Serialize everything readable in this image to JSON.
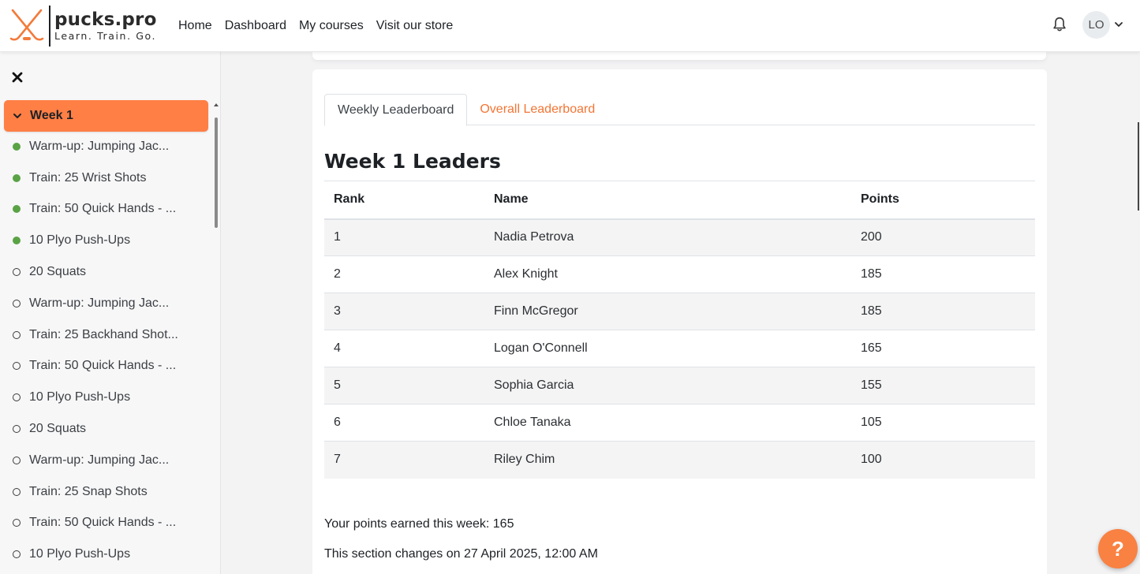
{
  "brand": {
    "name": "pucks.pro",
    "tagline": "Learn. Train. Go.",
    "accent_color": "#ff7f45",
    "stick_color": "#f37a3a"
  },
  "nav": {
    "links": [
      "Home",
      "Dashboard",
      "My courses",
      "Visit our store"
    ]
  },
  "user": {
    "initials": "LO"
  },
  "course_index": {
    "section_title": "Week 1",
    "activities": [
      {
        "label": "Warm-up: Jumping Jac...",
        "completed": true
      },
      {
        "label": "Train: 25 Wrist Shots",
        "completed": true
      },
      {
        "label": "Train: 50 Quick Hands - ...",
        "completed": true
      },
      {
        "label": "10 Plyo Push-Ups",
        "completed": true
      },
      {
        "label": "20 Squats",
        "completed": false
      },
      {
        "label": "Warm-up: Jumping Jac...",
        "completed": false
      },
      {
        "label": "Train: 25 Backhand Shot...",
        "completed": false
      },
      {
        "label": "Train: 50 Quick Hands - ...",
        "completed": false
      },
      {
        "label": "10 Plyo Push-Ups",
        "completed": false
      },
      {
        "label": "20 Squats",
        "completed": false
      },
      {
        "label": "Warm-up: Jumping Jac...",
        "completed": false
      },
      {
        "label": "Train: 25 Snap Shots",
        "completed": false
      },
      {
        "label": "Train: 50 Quick Hands - ...",
        "completed": false
      },
      {
        "label": "10 Plyo Push-Ups",
        "completed": false
      }
    ]
  },
  "tabs": {
    "weekly": "Weekly Leaderboard",
    "overall": "Overall Leaderboard"
  },
  "leaderboard": {
    "heading": "Week 1 Leaders",
    "columns": {
      "rank": "Rank",
      "name": "Name",
      "points": "Points"
    },
    "rows": [
      {
        "rank": "1",
        "name": "Nadia Petrova",
        "points": "200"
      },
      {
        "rank": "2",
        "name": "Alex Knight",
        "points": "185"
      },
      {
        "rank": "3",
        "name": "Finn McGregor",
        "points": "185"
      },
      {
        "rank": "4",
        "name": "Logan O'Connell",
        "points": "165"
      },
      {
        "rank": "5",
        "name": "Sophia Garcia",
        "points": "155"
      },
      {
        "rank": "6",
        "name": "Chloe Tanaka",
        "points": "105"
      },
      {
        "rank": "7",
        "name": "Riley Chim",
        "points": "100"
      }
    ]
  },
  "footer_notes": {
    "points_earned": "Your points earned this week: 165",
    "section_changes": "This section changes on 27 April 2025, 12:00 AM"
  },
  "help": {
    "label": "?"
  }
}
